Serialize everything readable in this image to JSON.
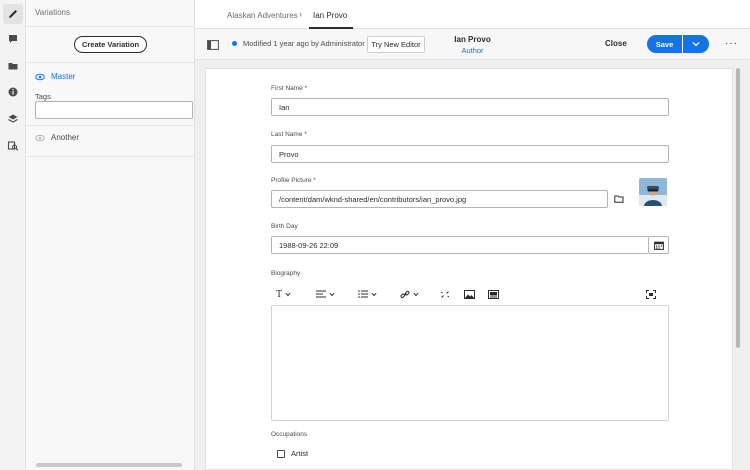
{
  "panel": {
    "title": "Variations",
    "create_button": "Create Variation",
    "variations": [
      {
        "label": "Master",
        "active": true
      },
      {
        "label": "Another",
        "active": false
      }
    ],
    "tags_label": "Tags",
    "tags_value": ""
  },
  "breadcrumb": {
    "parent": "Alaskan Adventures",
    "current": "Ian Provo"
  },
  "toolbar": {
    "status": "Modified 1 year ago by Administrator",
    "try_button": "Try New Editor",
    "title": "Ian Provo",
    "subtitle": "Author",
    "close": "Close",
    "save": "Save",
    "more": "···"
  },
  "form": {
    "first_name": {
      "label": "First Name *",
      "value": "Ian"
    },
    "last_name": {
      "label": "Last Name *",
      "value": "Provo"
    },
    "profile_picture": {
      "label": "Profile Picture *",
      "value": "/content/dam/wknd-shared/en/contributors/ian_provo.jpg"
    },
    "birth_day": {
      "label": "Birth Day",
      "value": "1988-09-26 22:09"
    },
    "biography": {
      "label": "Biography",
      "value": ""
    },
    "occupations": {
      "label": "Occupations",
      "options": [
        "Artist"
      ]
    }
  },
  "colors": {
    "accent": "#1473e6"
  },
  "icons": [
    "edit-icon",
    "comment-icon",
    "folder-icon",
    "info-icon",
    "layers-icon",
    "search-icon",
    "eye-icon",
    "panel-toggle-icon",
    "chevron-down-icon",
    "calendar-icon",
    "text-icon",
    "align-icon",
    "list-icon",
    "link-icon",
    "unlink-icon",
    "image-icon",
    "fullscreen-icon"
  ]
}
